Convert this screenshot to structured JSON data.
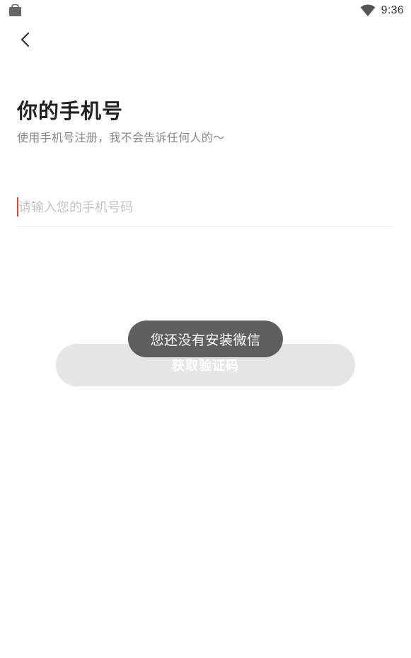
{
  "status_bar": {
    "time": "9:36",
    "notification_icon": "shopping-bag-icon",
    "wifi_icon": "wifi-icon"
  },
  "nav": {
    "back_icon": "chevron-left-icon"
  },
  "header": {
    "title": "你的手机号",
    "subtitle": "使用手机号注册，我不会告诉任何人的〜"
  },
  "form": {
    "phone_value": "",
    "phone_placeholder": "请输入您的手机号码",
    "cursor_color": "#d9482f",
    "submit_label": "获取验证码",
    "submit_enabled": false
  },
  "toast": {
    "message": "您还没有安装微信"
  },
  "colors": {
    "background": "#ffffff",
    "title": "#222222",
    "subtitle": "#888888",
    "button_disabled": "#e5e5e5",
    "toast_bg": "#585858"
  }
}
